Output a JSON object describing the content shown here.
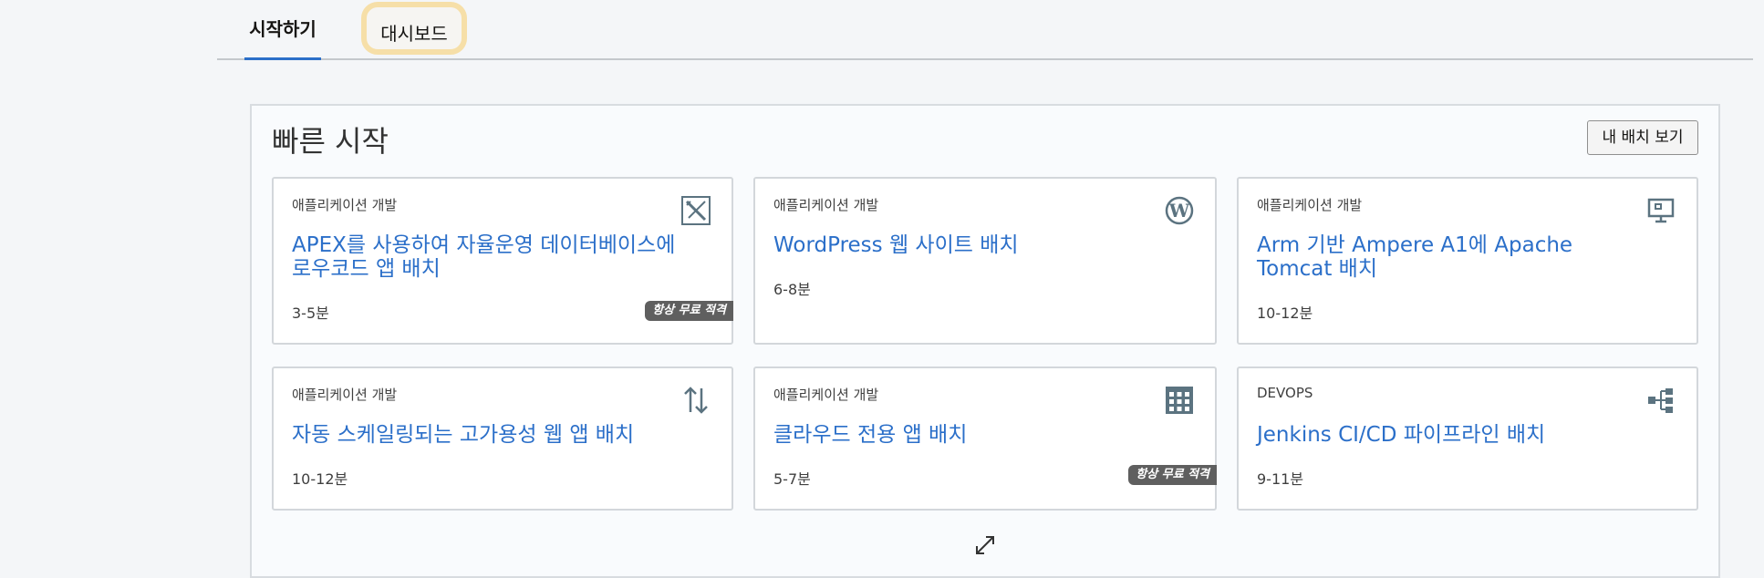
{
  "tabs": [
    {
      "label": "시작하기",
      "active": true
    },
    {
      "label": "대시보드",
      "active": false
    }
  ],
  "quick_start": {
    "title": "빠른 시작",
    "view_deployments_label": "내 배치 보기"
  },
  "cards": [
    {
      "category": "애플리케이션 개발",
      "title": "APEX를 사용하여 자율운영 데이터베이스에 로우코드 앱 배치",
      "time": "3-5분",
      "badge": "항상 무료 적격",
      "icon": "apex-tools-icon"
    },
    {
      "category": "애플리케이션 개발",
      "title": "WordPress 웹 사이트 배치",
      "time": "6-8분",
      "badge": "",
      "icon": "wordpress-icon"
    },
    {
      "category": "애플리케이션 개발",
      "title": "Arm 기반 Ampere A1에 Apache Tomcat 배치",
      "time": "10-12분",
      "badge": "",
      "icon": "monitor-icon"
    },
    {
      "category": "애플리케이션 개발",
      "title": "자동 스케일링되는 고가용성 웹 앱 배치",
      "time": "10-12분",
      "badge": "",
      "icon": "arrows-up-down-icon"
    },
    {
      "category": "애플리케이션 개발",
      "title": "클라우드 전용 앱 배치",
      "time": "5-7분",
      "badge": "항상 무료 적격",
      "icon": "grid-icon"
    },
    {
      "category": "DEVOPS",
      "title": "Jenkins CI/CD 파이프라인 배치",
      "time": "9-11분",
      "badge": "",
      "icon": "pipeline-icon"
    }
  ],
  "colors": {
    "accent": "#2b6fc9",
    "tab_highlight": "#f6dfa8",
    "badge": "#5f5f5f"
  }
}
